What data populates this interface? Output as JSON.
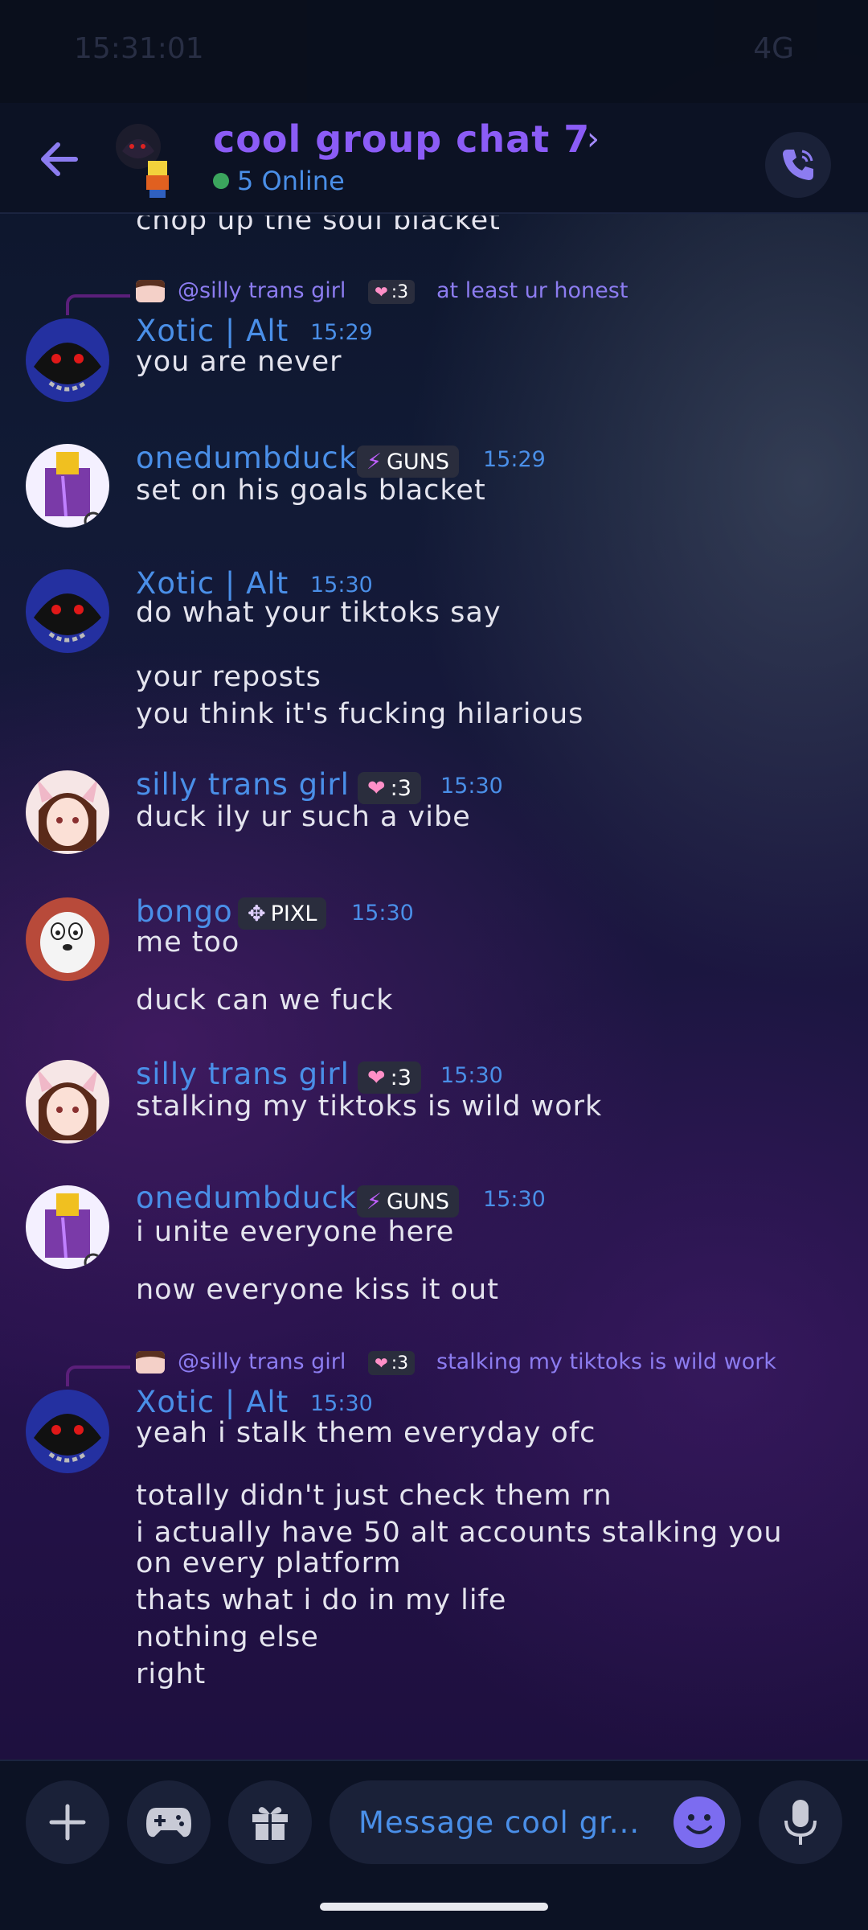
{
  "status": {
    "time": "15:31:01",
    "network": "4G"
  },
  "header": {
    "title": "cool group chat 7",
    "online": "5 Online"
  },
  "messages": {
    "m0": {
      "text": "chop up the soul blacket"
    },
    "m1": {
      "reply_user": "@silly trans girl",
      "reply_tag": ":3",
      "reply_text": "at least ur honest",
      "name": "Xotic | Alt",
      "time": "15:29",
      "lines": [
        "you are never"
      ]
    },
    "m2": {
      "name": "onedumbduck",
      "tag": "GUNS",
      "time": "15:29",
      "lines": [
        "set on his goals blacket"
      ]
    },
    "m3": {
      "name": "Xotic | Alt",
      "time": "15:30",
      "lines": [
        "do what your tiktoks say",
        "your reposts",
        "you think it's fucking hilarious"
      ]
    },
    "m4": {
      "name": "silly trans girl",
      "tag": ":3",
      "time": "15:30",
      "lines": [
        "duck ily ur such a vibe"
      ]
    },
    "m5": {
      "name": "bongo",
      "tag": "PIXL",
      "time": "15:30",
      "lines": [
        "me too",
        "duck can we fuck"
      ]
    },
    "m6": {
      "name": "silly trans girl",
      "tag": ":3",
      "time": "15:30",
      "lines": [
        "stalking my tiktoks is wild work"
      ]
    },
    "m7": {
      "name": "onedumbduck",
      "tag": "GUNS",
      "time": "15:30",
      "lines": [
        "i unite everyone here",
        "now everyone kiss it out"
      ]
    },
    "m8": {
      "reply_user": "@silly trans girl",
      "reply_tag": ":3",
      "reply_text": "stalking my tiktoks is wild work",
      "name": "Xotic | Alt",
      "time": "15:30",
      "lines": [
        "yeah i stalk them everyday ofc",
        "totally didn't just check them rn",
        "i actually have 50 alt accounts stalking you",
        "on every platform",
        "thats what i do in my life",
        "nothing else",
        "right"
      ]
    }
  },
  "input": {
    "placeholder": "Message cool gr..."
  },
  "colors": {
    "accent": "#8b5cf6",
    "name": "#4a8fe8",
    "online": "#3ba55d"
  },
  "icons": [
    "back-arrow-icon",
    "phone-icon",
    "plus-icon",
    "gamepad-icon",
    "gift-icon",
    "emoji-icon",
    "mic-icon"
  ]
}
